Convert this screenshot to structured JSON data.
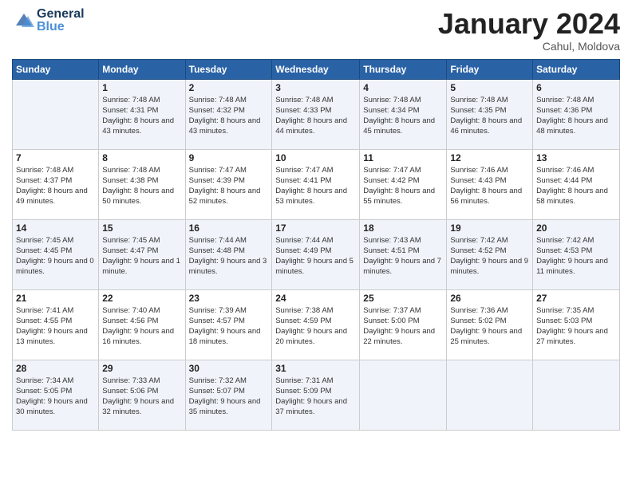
{
  "header": {
    "logo_general": "General",
    "logo_blue": "Blue",
    "month_title": "January 2024",
    "location": "Cahul, Moldova"
  },
  "weekdays": [
    "Sunday",
    "Monday",
    "Tuesday",
    "Wednesday",
    "Thursday",
    "Friday",
    "Saturday"
  ],
  "weeks": [
    [
      {
        "day": "",
        "sunrise": "",
        "sunset": "",
        "daylight": ""
      },
      {
        "day": "1",
        "sunrise": "Sunrise: 7:48 AM",
        "sunset": "Sunset: 4:31 PM",
        "daylight": "Daylight: 8 hours and 43 minutes."
      },
      {
        "day": "2",
        "sunrise": "Sunrise: 7:48 AM",
        "sunset": "Sunset: 4:32 PM",
        "daylight": "Daylight: 8 hours and 43 minutes."
      },
      {
        "day": "3",
        "sunrise": "Sunrise: 7:48 AM",
        "sunset": "Sunset: 4:33 PM",
        "daylight": "Daylight: 8 hours and 44 minutes."
      },
      {
        "day": "4",
        "sunrise": "Sunrise: 7:48 AM",
        "sunset": "Sunset: 4:34 PM",
        "daylight": "Daylight: 8 hours and 45 minutes."
      },
      {
        "day": "5",
        "sunrise": "Sunrise: 7:48 AM",
        "sunset": "Sunset: 4:35 PM",
        "daylight": "Daylight: 8 hours and 46 minutes."
      },
      {
        "day": "6",
        "sunrise": "Sunrise: 7:48 AM",
        "sunset": "Sunset: 4:36 PM",
        "daylight": "Daylight: 8 hours and 48 minutes."
      }
    ],
    [
      {
        "day": "7",
        "sunrise": "Sunrise: 7:48 AM",
        "sunset": "Sunset: 4:37 PM",
        "daylight": "Daylight: 8 hours and 49 minutes."
      },
      {
        "day": "8",
        "sunrise": "Sunrise: 7:48 AM",
        "sunset": "Sunset: 4:38 PM",
        "daylight": "Daylight: 8 hours and 50 minutes."
      },
      {
        "day": "9",
        "sunrise": "Sunrise: 7:47 AM",
        "sunset": "Sunset: 4:39 PM",
        "daylight": "Daylight: 8 hours and 52 minutes."
      },
      {
        "day": "10",
        "sunrise": "Sunrise: 7:47 AM",
        "sunset": "Sunset: 4:41 PM",
        "daylight": "Daylight: 8 hours and 53 minutes."
      },
      {
        "day": "11",
        "sunrise": "Sunrise: 7:47 AM",
        "sunset": "Sunset: 4:42 PM",
        "daylight": "Daylight: 8 hours and 55 minutes."
      },
      {
        "day": "12",
        "sunrise": "Sunrise: 7:46 AM",
        "sunset": "Sunset: 4:43 PM",
        "daylight": "Daylight: 8 hours and 56 minutes."
      },
      {
        "day": "13",
        "sunrise": "Sunrise: 7:46 AM",
        "sunset": "Sunset: 4:44 PM",
        "daylight": "Daylight: 8 hours and 58 minutes."
      }
    ],
    [
      {
        "day": "14",
        "sunrise": "Sunrise: 7:45 AM",
        "sunset": "Sunset: 4:45 PM",
        "daylight": "Daylight: 9 hours and 0 minutes."
      },
      {
        "day": "15",
        "sunrise": "Sunrise: 7:45 AM",
        "sunset": "Sunset: 4:47 PM",
        "daylight": "Daylight: 9 hours and 1 minute."
      },
      {
        "day": "16",
        "sunrise": "Sunrise: 7:44 AM",
        "sunset": "Sunset: 4:48 PM",
        "daylight": "Daylight: 9 hours and 3 minutes."
      },
      {
        "day": "17",
        "sunrise": "Sunrise: 7:44 AM",
        "sunset": "Sunset: 4:49 PM",
        "daylight": "Daylight: 9 hours and 5 minutes."
      },
      {
        "day": "18",
        "sunrise": "Sunrise: 7:43 AM",
        "sunset": "Sunset: 4:51 PM",
        "daylight": "Daylight: 9 hours and 7 minutes."
      },
      {
        "day": "19",
        "sunrise": "Sunrise: 7:42 AM",
        "sunset": "Sunset: 4:52 PM",
        "daylight": "Daylight: 9 hours and 9 minutes."
      },
      {
        "day": "20",
        "sunrise": "Sunrise: 7:42 AM",
        "sunset": "Sunset: 4:53 PM",
        "daylight": "Daylight: 9 hours and 11 minutes."
      }
    ],
    [
      {
        "day": "21",
        "sunrise": "Sunrise: 7:41 AM",
        "sunset": "Sunset: 4:55 PM",
        "daylight": "Daylight: 9 hours and 13 minutes."
      },
      {
        "day": "22",
        "sunrise": "Sunrise: 7:40 AM",
        "sunset": "Sunset: 4:56 PM",
        "daylight": "Daylight: 9 hours and 16 minutes."
      },
      {
        "day": "23",
        "sunrise": "Sunrise: 7:39 AM",
        "sunset": "Sunset: 4:57 PM",
        "daylight": "Daylight: 9 hours and 18 minutes."
      },
      {
        "day": "24",
        "sunrise": "Sunrise: 7:38 AM",
        "sunset": "Sunset: 4:59 PM",
        "daylight": "Daylight: 9 hours and 20 minutes."
      },
      {
        "day": "25",
        "sunrise": "Sunrise: 7:37 AM",
        "sunset": "Sunset: 5:00 PM",
        "daylight": "Daylight: 9 hours and 22 minutes."
      },
      {
        "day": "26",
        "sunrise": "Sunrise: 7:36 AM",
        "sunset": "Sunset: 5:02 PM",
        "daylight": "Daylight: 9 hours and 25 minutes."
      },
      {
        "day": "27",
        "sunrise": "Sunrise: 7:35 AM",
        "sunset": "Sunset: 5:03 PM",
        "daylight": "Daylight: 9 hours and 27 minutes."
      }
    ],
    [
      {
        "day": "28",
        "sunrise": "Sunrise: 7:34 AM",
        "sunset": "Sunset: 5:05 PM",
        "daylight": "Daylight: 9 hours and 30 minutes."
      },
      {
        "day": "29",
        "sunrise": "Sunrise: 7:33 AM",
        "sunset": "Sunset: 5:06 PM",
        "daylight": "Daylight: 9 hours and 32 minutes."
      },
      {
        "day": "30",
        "sunrise": "Sunrise: 7:32 AM",
        "sunset": "Sunset: 5:07 PM",
        "daylight": "Daylight: 9 hours and 35 minutes."
      },
      {
        "day": "31",
        "sunrise": "Sunrise: 7:31 AM",
        "sunset": "Sunset: 5:09 PM",
        "daylight": "Daylight: 9 hours and 37 minutes."
      },
      {
        "day": "",
        "sunrise": "",
        "sunset": "",
        "daylight": ""
      },
      {
        "day": "",
        "sunrise": "",
        "sunset": "",
        "daylight": ""
      },
      {
        "day": "",
        "sunrise": "",
        "sunset": "",
        "daylight": ""
      }
    ]
  ]
}
